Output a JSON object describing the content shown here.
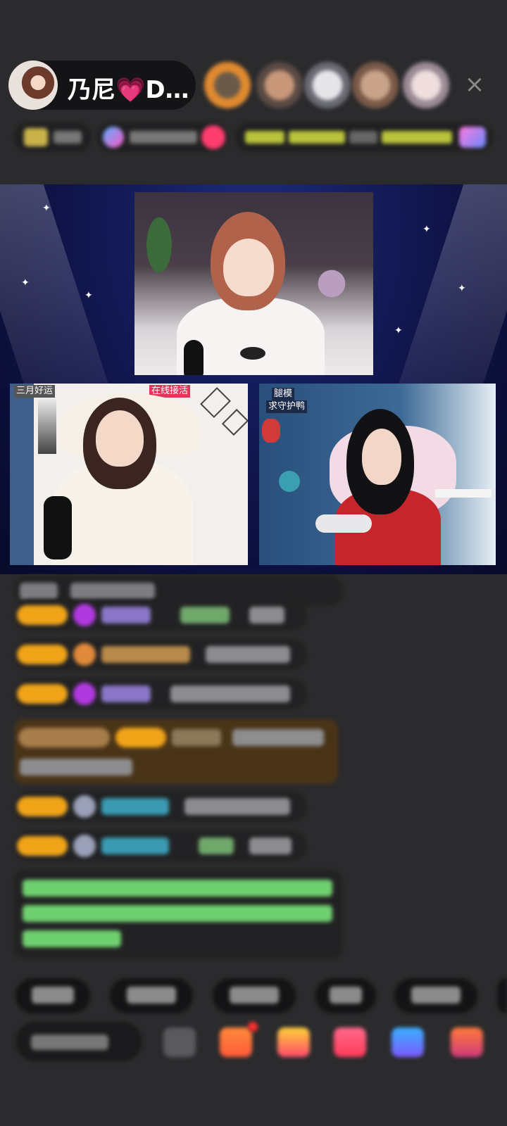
{
  "header": {
    "host_name": "乃尼💗D…",
    "close_label": "×",
    "viewers": [
      "viewer-1",
      "viewer-2",
      "viewer-3",
      "viewer-4",
      "viewer-5"
    ]
  },
  "stage": {
    "left_tags": [
      "三月好运",
      "在线接活"
    ],
    "right_tags": [
      "腿模",
      "求守护鸭"
    ]
  },
  "colors": {
    "background": "#2b2b2d",
    "stage": "#0f1347",
    "badge": "#f0a418",
    "highlight_row": "#4a3418",
    "system_text": "#6fd06f"
  }
}
